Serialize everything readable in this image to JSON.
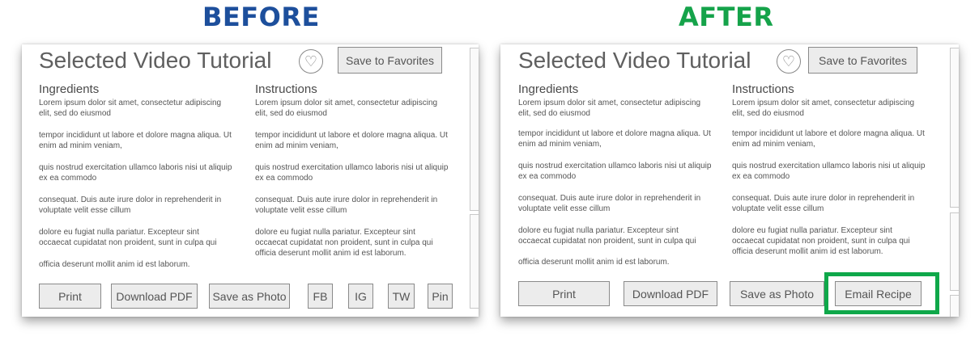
{
  "labels": {
    "before": "BEFORE",
    "after": "AFTER"
  },
  "title": "Selected Video Tutorial",
  "save_favorites": "Save to Favorites",
  "ingredients_heading": "Ingredients",
  "instructions_heading": "Instructions",
  "paragraphs": [
    "Lorem ipsum dolor sit amet, consectetur adipiscing elit, sed do eiusmod",
    "tempor incididunt ut labore et dolore magna aliqua. Ut enim ad minim veniam,",
    "quis nostrud exercitation ullamco laboris nisi ut aliquip ex ea commodo",
    "consequat. Duis aute irure dolor in reprehenderit in voluptate velit esse cillum",
    "dolore eu fugiat nulla pariatur. Excepteur sint occaecat cupidatat non proident, sunt in culpa qui",
    "officia deserunt mollit anim id est laborum."
  ],
  "instructions_last": "dolore eu fugiat nulla pariatur. Excepteur sint occaecat cupidatat non proident, sunt in culpa qui officia deserunt mollit anim id est laborum.",
  "buttons_before": {
    "print": "Print",
    "download": "Download PDF",
    "photo": "Save as Photo",
    "fb": "FB",
    "ig": "IG",
    "tw": "TW",
    "pin": "Pin"
  },
  "buttons_after": {
    "print": "Print",
    "download": "Download PDF",
    "photo": "Save as Photo",
    "email": "Email Recipe"
  },
  "colors": {
    "before_label": "#1d4f9c",
    "after_label": "#15a34a",
    "highlight": "#0fa84a"
  },
  "icons": {
    "favorite": "heart-icon"
  }
}
